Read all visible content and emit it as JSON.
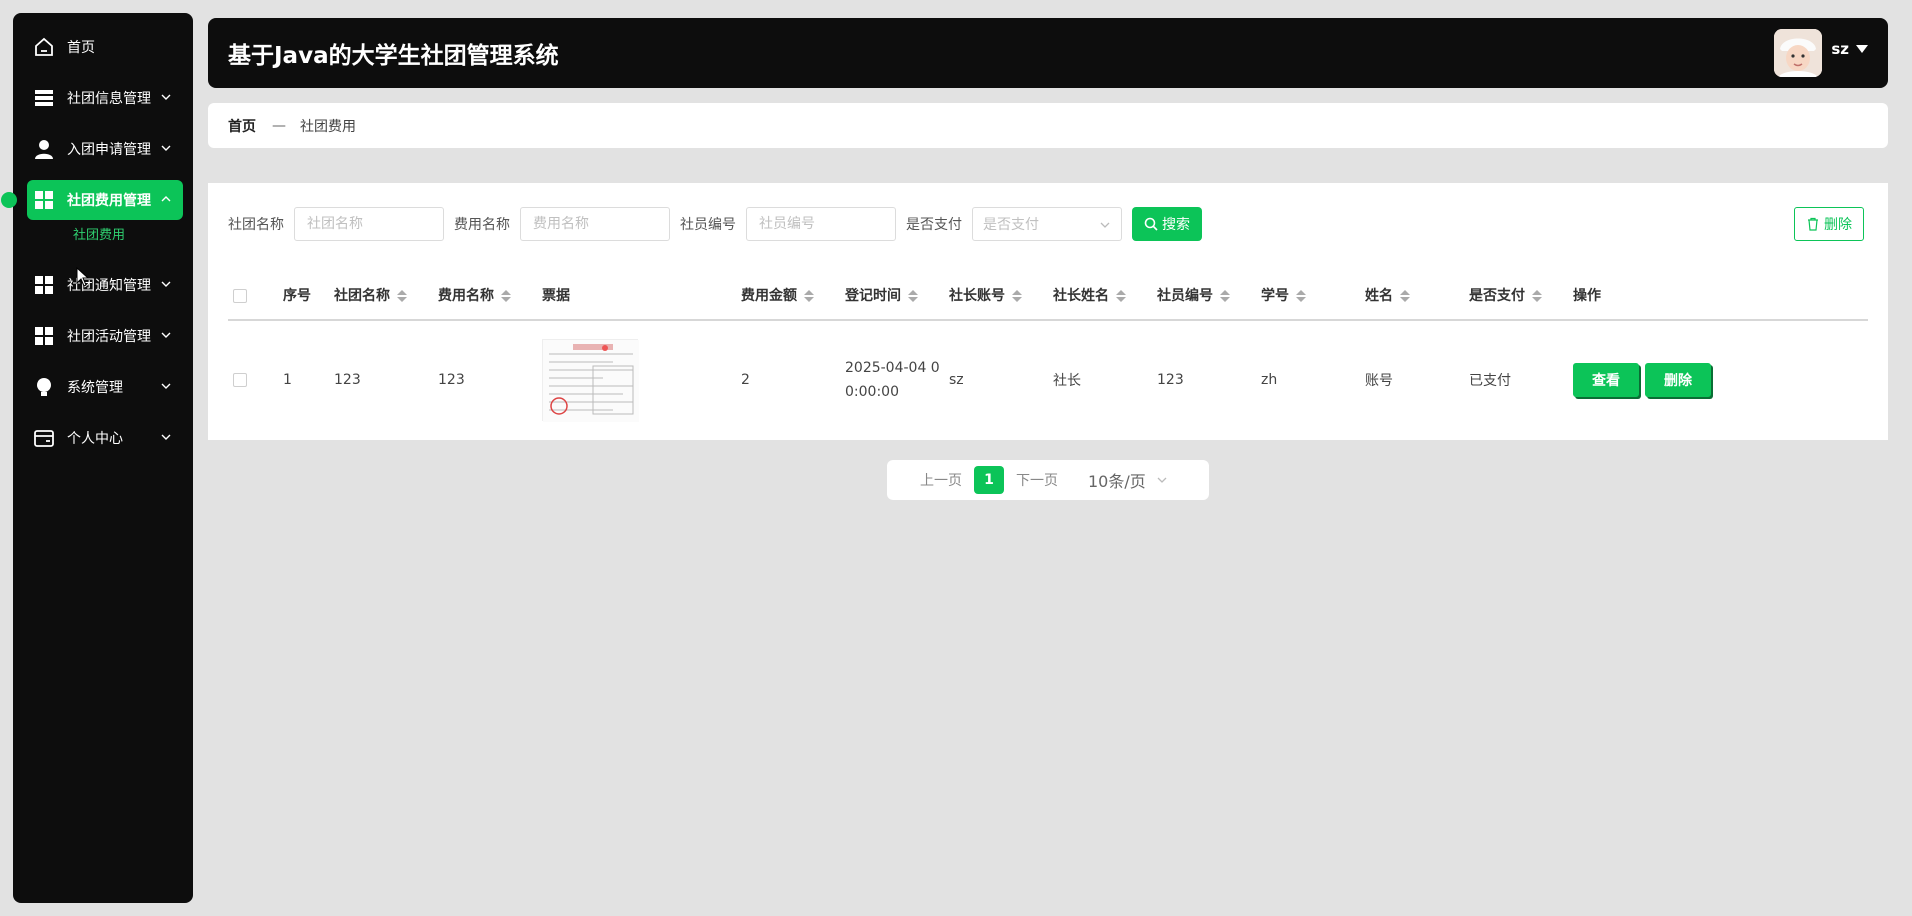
{
  "app": {
    "title": "基于Java的大学生社团管理系统",
    "user": "sz"
  },
  "sidebar": {
    "items": [
      {
        "label": "首页",
        "icon": "home-icon"
      },
      {
        "label": "社团信息管理",
        "icon": "list-icon"
      },
      {
        "label": "入团申请管理",
        "icon": "user-icon"
      },
      {
        "label": "社团费用管理",
        "icon": "grid-icon",
        "active": true
      },
      {
        "label": "社团通知管理",
        "icon": "grid-icon"
      },
      {
        "label": "社团活动管理",
        "icon": "grid-icon"
      },
      {
        "label": "系统管理",
        "icon": "bulb-icon"
      },
      {
        "label": "个人中心",
        "icon": "card-icon"
      }
    ],
    "sub_item": "社团费用"
  },
  "breadcrumb": {
    "home": "首页",
    "separator": "—",
    "current": "社团费用"
  },
  "filters": {
    "club_name": {
      "label": "社团名称",
      "placeholder": "社团名称"
    },
    "fee_name": {
      "label": "费用名称",
      "placeholder": "费用名称"
    },
    "member_no": {
      "label": "社员编号",
      "placeholder": "社员编号"
    },
    "paid": {
      "label": "是否支付",
      "placeholder": "是否支付"
    },
    "search_label": "搜索",
    "delete_label": "删除"
  },
  "table": {
    "headers": [
      "序号",
      "社团名称",
      "费用名称",
      "票据",
      "费用金额",
      "登记时间",
      "社长账号",
      "社长姓名",
      "社员编号",
      "学号",
      "姓名",
      "是否支付",
      "操作"
    ],
    "rows": [
      {
        "index": "1",
        "club_name": "123",
        "fee_name": "123",
        "amount": "2",
        "time_line1": "2025-04-04 0",
        "time_line2": "0:00:00",
        "leader_account": "sz",
        "leader_name": "社长",
        "member_no": "123",
        "student_no": "zh",
        "name": "账号",
        "paid": "已支付",
        "view_label": "查看",
        "delete_label": "删除"
      }
    ]
  },
  "pagination": {
    "prev": "上一页",
    "page": "1",
    "next": "下一页",
    "page_size": "10条/页"
  },
  "colors": {
    "accent": "#0cc458",
    "dark": "#0d0d0d",
    "background": "#e2e2e2"
  }
}
